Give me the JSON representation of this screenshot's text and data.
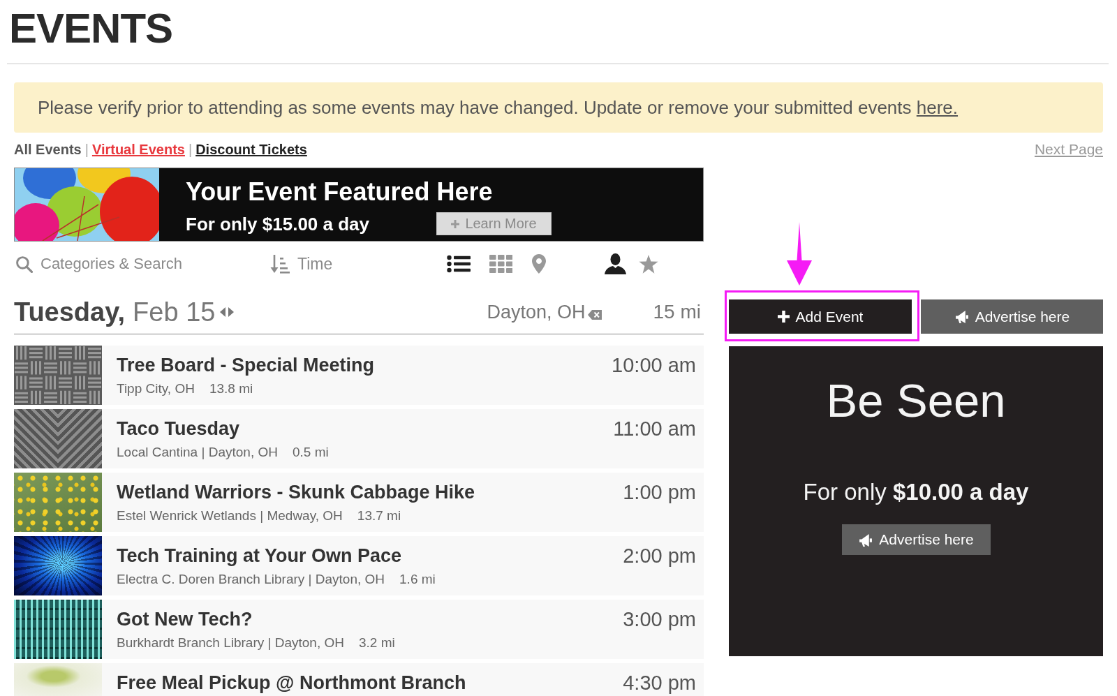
{
  "page_title": "EVENTS",
  "notice": {
    "text": "Please verify prior to attending as some events may have changed. Update or remove your submitted events",
    "link": "here."
  },
  "nav": {
    "links": [
      {
        "label": "All Events",
        "selected": true,
        "color": "#555555"
      },
      {
        "label": "Virtual Events",
        "selected": false,
        "color": "#e8383d"
      },
      {
        "label": "Discount Tickets",
        "selected": false,
        "color": "#222222"
      }
    ],
    "separator": "|",
    "next_page": "Next Page"
  },
  "featured_banner": {
    "title": "Your Event Featured Here",
    "subtitle": "For only $15.00 a day",
    "button": "Learn More"
  },
  "toolbar": {
    "search": {
      "placeholder": "Categories & Search"
    },
    "sort": "Time",
    "views": [
      {
        "kind": "list",
        "selected": true
      },
      {
        "kind": "grid",
        "selected": false
      },
      {
        "kind": "map",
        "selected": false
      }
    ],
    "filters": [
      {
        "kind": "person",
        "selected": true
      },
      {
        "kind": "star",
        "selected": false
      }
    ]
  },
  "date_header": {
    "weekday": "Tuesday,",
    "date": "Feb 15",
    "location": "Dayton, OH",
    "radius": "15 mi"
  },
  "events": [
    {
      "title": "Tree Board - Special Meeting",
      "place": "Tipp City, OH",
      "distance": "13.8 mi",
      "time": "10:00 am",
      "thumbnail": {
        "kind": "weave"
      }
    },
    {
      "title": "Taco Tuesday",
      "place": "Local Cantina | Dayton, OH",
      "distance": "0.5 mi",
      "time": "11:00 am",
      "thumbnail": {
        "kind": "chevron"
      }
    },
    {
      "title": "Wetland Warriors - Skunk Cabbage Hike",
      "place": "Estel Wenrick Wetlands | Medway, OH",
      "distance": "13.7 mi",
      "time": "1:00 pm",
      "thumbnail": {
        "kind": "flowers"
      }
    },
    {
      "title": "Tech Training at Your Own Pace",
      "place": "Electra C. Doren Branch Library | Dayton, OH",
      "distance": "1.6 mi",
      "time": "2:00 pm",
      "thumbnail": {
        "kind": "tunnel"
      }
    },
    {
      "title": "Got New Tech?",
      "place": "Burkhardt Branch Library | Dayton, OH",
      "distance": "3.2 mi",
      "time": "3:00 pm",
      "thumbnail": {
        "kind": "circuit"
      }
    },
    {
      "title": "Free Meal Pickup @ Northmont Branch",
      "time": "4:30 pm",
      "thumbnail": {
        "kind": "food"
      }
    }
  ],
  "sidebar": {
    "add_event_button": {
      "label": "Add Event",
      "highlighted": true
    },
    "advertise_button": "Advertise here",
    "ad": {
      "title": "Be Seen",
      "text": "For only **$10.00 a day**",
      "button": "Advertise here"
    }
  }
}
